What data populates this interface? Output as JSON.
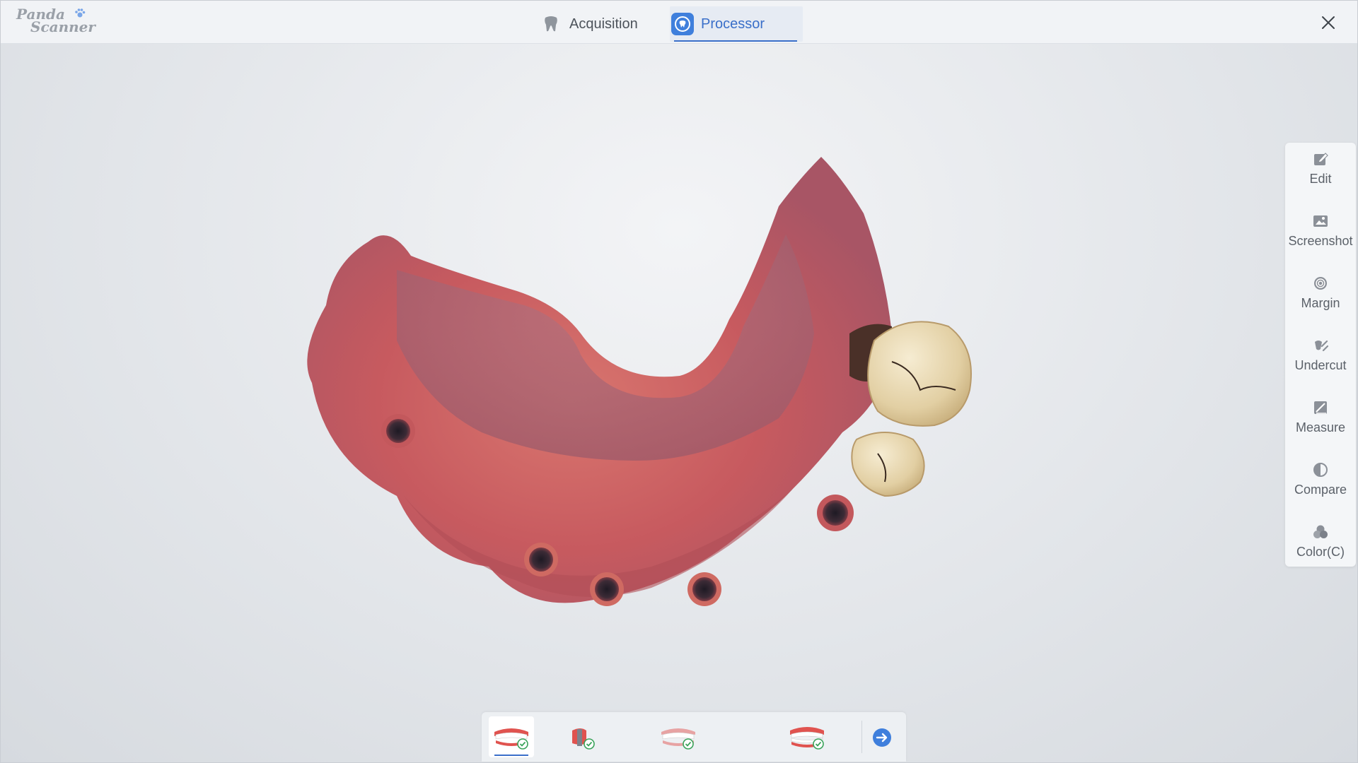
{
  "app": {
    "logo_line1": "Panda",
    "logo_line2": "Scanner"
  },
  "tabs": [
    {
      "label": "Acquisition",
      "icon": "tooth-icon",
      "active": false
    },
    {
      "label": "Processor",
      "icon": "processor-icon",
      "active": true
    }
  ],
  "tools": [
    {
      "label": "Edit",
      "icon": "edit-icon"
    },
    {
      "label": "Screenshot",
      "icon": "image-icon"
    },
    {
      "label": "Margin",
      "icon": "margin-icon"
    },
    {
      "label": "Undercut",
      "icon": "undercut-icon"
    },
    {
      "label": "Measure",
      "icon": "measure-icon"
    },
    {
      "label": "Compare",
      "icon": "half-circle-icon"
    },
    {
      "label": "Color(C)",
      "icon": "color-circles-icon"
    }
  ],
  "steps": [
    {
      "icon": "upper-jaw-check-icon",
      "done": true,
      "active": true
    },
    {
      "icon": "scanbody-check-icon",
      "done": true,
      "active": false
    },
    {
      "icon": "lower-jaw-check-icon",
      "done": true,
      "active": false
    },
    {
      "icon": "bite-check-icon",
      "done": true,
      "active": false
    }
  ],
  "colors": {
    "accent": "#3a6fc9",
    "check": "#3aa35a",
    "gum": "#c9545a"
  }
}
